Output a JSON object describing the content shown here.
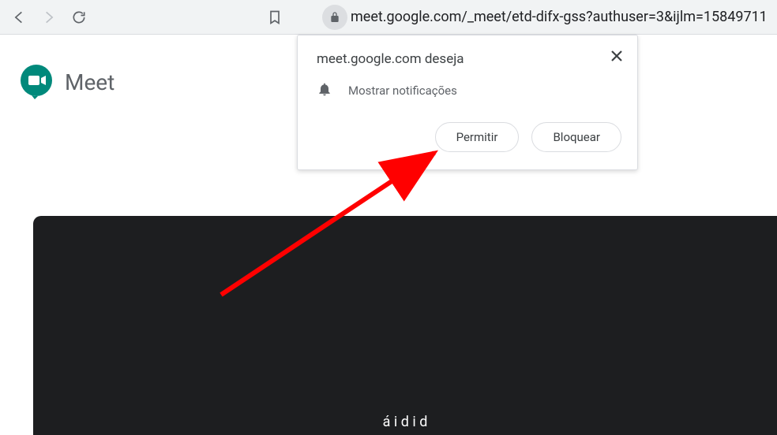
{
  "toolbar": {
    "url": "meet.google.com/_meet/etd-difx-gss?authuser=3&ijlm=15849711"
  },
  "brand": {
    "name": "Meet"
  },
  "popup": {
    "title": "meet.google.com deseja",
    "permission_label": "Mostrar notificações",
    "allow_label": "Permitir",
    "block_label": "Bloquear"
  },
  "video": {
    "caption_fragment": "á i d i d"
  }
}
